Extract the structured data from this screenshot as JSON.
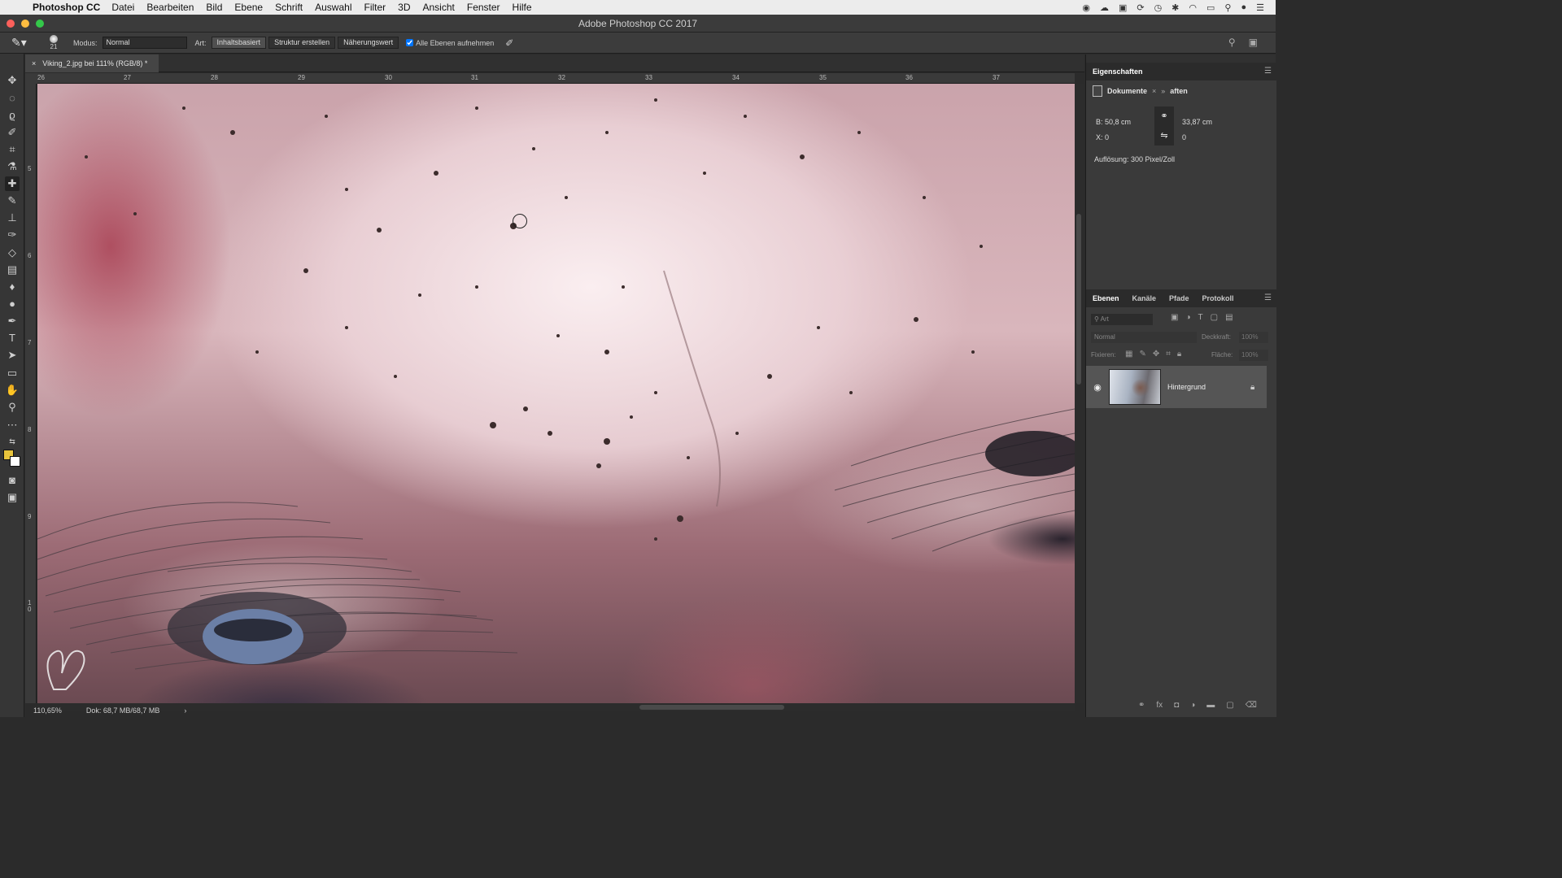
{
  "menubar": {
    "app": "Photoshop CC",
    "items": [
      "Datei",
      "Bearbeiten",
      "Bild",
      "Ebene",
      "Schrift",
      "Auswahl",
      "Filter",
      "3D",
      "Ansicht",
      "Fenster",
      "Hilfe"
    ]
  },
  "window": {
    "title": "Adobe Photoshop CC 2017"
  },
  "options": {
    "brush_size": "21",
    "mode_label": "Modus:",
    "mode_value": "Normal",
    "type_label": "Art:",
    "type_buttons": [
      "Inhaltsbasiert",
      "Struktur erstellen",
      "Näherungswert"
    ],
    "sample_all_label": "Alle Ebenen aufnehmen",
    "sample_all_checked": true
  },
  "document": {
    "tab_title": "Viking_2.jpg bei 111% (RGB/8) *",
    "ruler_h": [
      "26",
      "27",
      "28",
      "29",
      "30",
      "31",
      "32",
      "33",
      "34",
      "35",
      "36",
      "37"
    ],
    "ruler_v": [
      "5",
      "6",
      "7",
      "8",
      "9",
      "1 0"
    ]
  },
  "status": {
    "zoom": "110,65%",
    "doc_size": "Dok: 68,7 MB/68,7 MB"
  },
  "properties": {
    "title": "Eigenschaften",
    "sub_left": "Dokumente",
    "sub_right": "aften",
    "width": "B: 50,8 cm",
    "height": "33,87 cm",
    "x": "X: 0",
    "y": "0",
    "resolution": "Auflösung: 300 Pixel/Zoll"
  },
  "layers_panel": {
    "tabs": [
      "Ebenen",
      "Kanäle",
      "Pfade",
      "Protokoll"
    ],
    "search_placeholder": "Art",
    "blend_mode": "Normal",
    "opacity_label": "Deckkraft:",
    "opacity_value": "100%",
    "lock_label": "Fixieren:",
    "fill_label": "Fläche:",
    "fill_value": "100%",
    "layers": [
      {
        "name": "Hintergrund",
        "visible": true,
        "locked": true
      }
    ]
  },
  "colors": {
    "foreground": "#e8c43c",
    "background": "#ffffff"
  }
}
